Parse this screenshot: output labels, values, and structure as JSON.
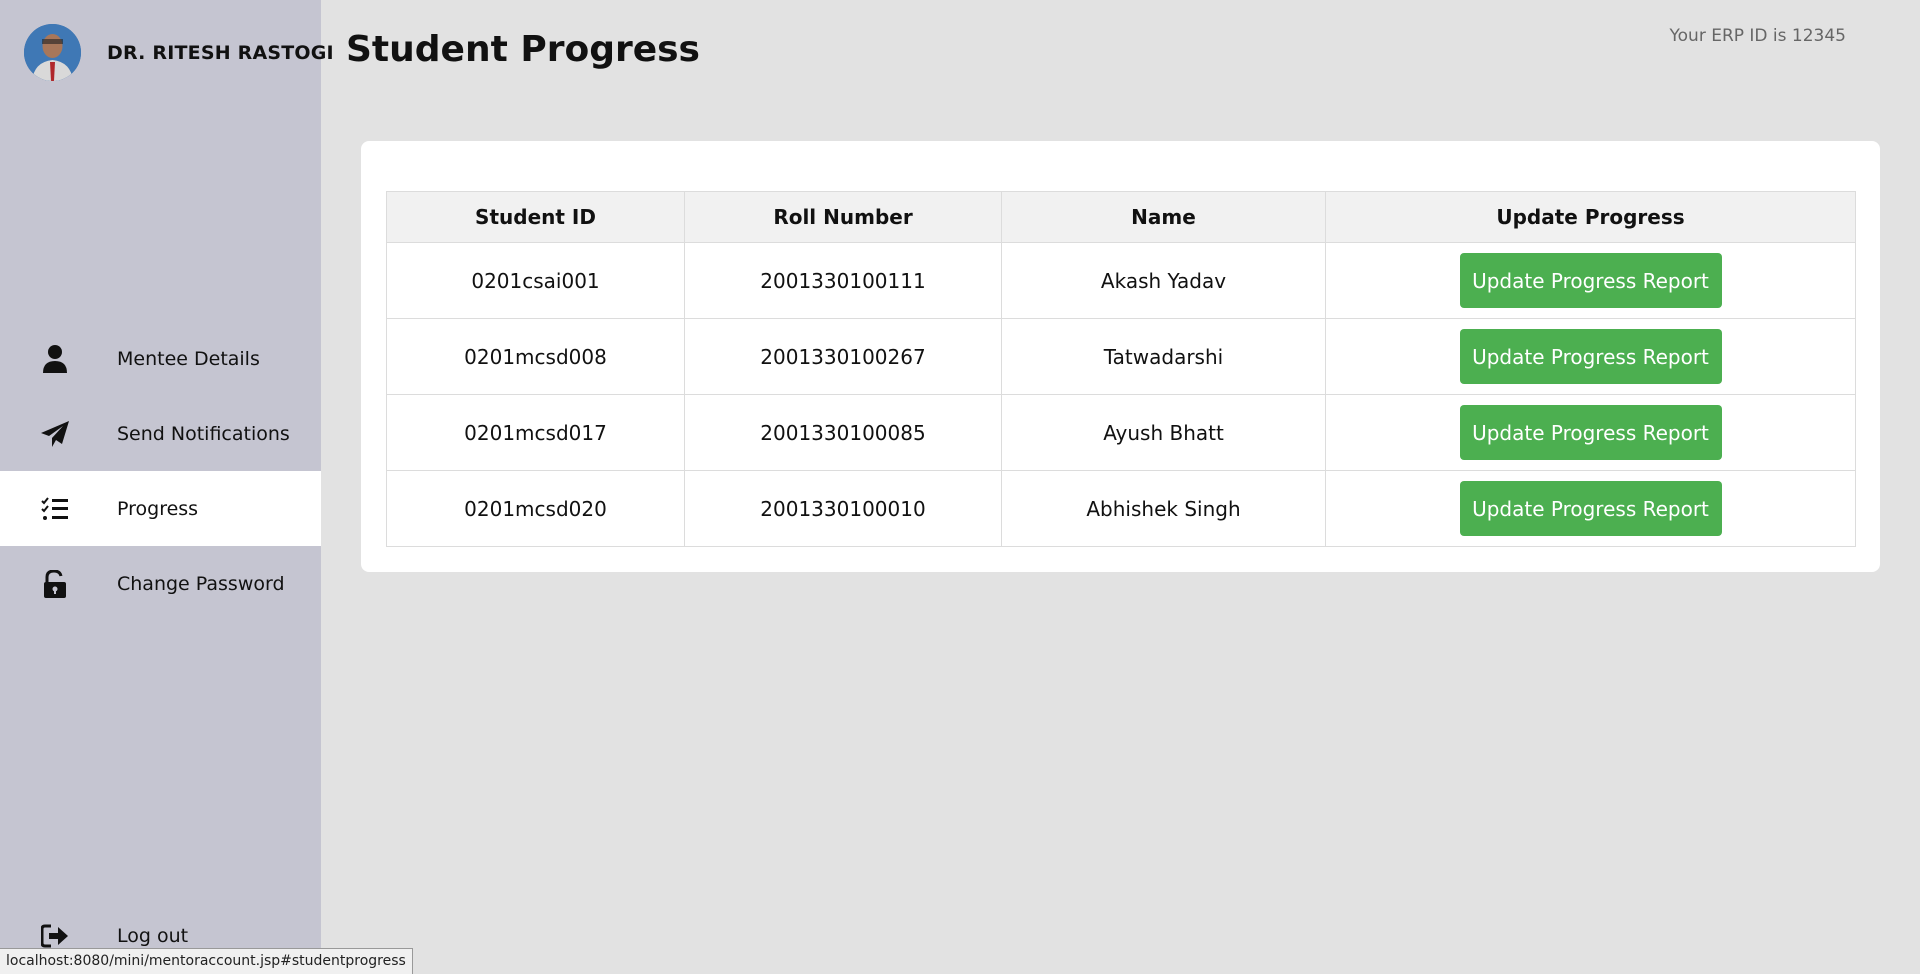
{
  "profile": {
    "name": "DR. RITESH RASTOGI"
  },
  "nav": [
    {
      "label": "Mentee Details",
      "icon": "user-icon"
    },
    {
      "label": "Send Notifications",
      "icon": "paper-plane-icon"
    },
    {
      "label": "Progress",
      "icon": "list-check-icon",
      "active": true
    },
    {
      "label": "Change Password",
      "icon": "unlock-icon"
    }
  ],
  "logout": {
    "label": "Log out",
    "icon": "sign-out-icon"
  },
  "header": {
    "title": "Student Progress",
    "erp_text": "Your ERP ID is 12345"
  },
  "table": {
    "headers": [
      "Student ID",
      "Roll Number",
      "Name",
      "Update Progress"
    ],
    "rows": [
      {
        "id": "0201csai001",
        "roll": "2001330100111",
        "name": "Akash Yadav",
        "action": "Update Progress Report"
      },
      {
        "id": "0201mcsd008",
        "roll": "2001330100267",
        "name": "Tatwadarshi",
        "action": "Update Progress Report"
      },
      {
        "id": "0201mcsd017",
        "roll": "2001330100085",
        "name": "Ayush Bhatt",
        "action": "Update Progress Report"
      },
      {
        "id": "0201mcsd020",
        "roll": "2001330100010",
        "name": "Abhishek Singh",
        "action": "Update Progress Report"
      }
    ]
  },
  "status_bar": {
    "url": "localhost:8080/mini/mentoraccount.jsp#studentprogress"
  },
  "colors": {
    "sidebar": "#c5c5d1",
    "background": "#e2e2e2",
    "button": "#4caf50"
  }
}
